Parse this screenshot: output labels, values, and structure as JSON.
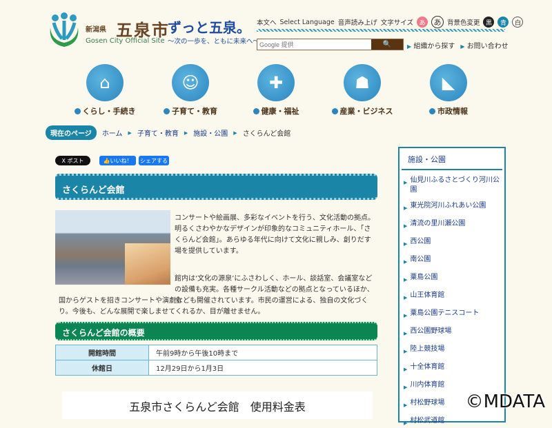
{
  "header": {
    "prefecture": "新潟県",
    "city": "五泉市",
    "english": "Gosen City Official Site",
    "slogan": "ずっと五泉。",
    "slogan_sub": "〜次の一歩を、ともに未来へ〜"
  },
  "utility": {
    "skip": "本文へ",
    "language": "Select Language",
    "read_aloud": "音声読み上げ",
    "font_size": "文字サイズ",
    "font_large": "あ",
    "font_normal": "あ",
    "bg_color": "背景色変更",
    "bg_black": "黒",
    "bg_blue": "青",
    "bg_white": "白"
  },
  "search": {
    "placeholder": "Google 提供",
    "button_icon": "search-icon"
  },
  "links": {
    "org": "組織から探す",
    "contact": "お問い合わせ"
  },
  "nav": [
    {
      "label": "くらし・手続き",
      "icon": "house-icon"
    },
    {
      "label": "子育て・教育",
      "icon": "baby-icon"
    },
    {
      "label": "健康・福祉",
      "icon": "health-icon"
    },
    {
      "label": "産業・ビジネス",
      "icon": "business-icon"
    },
    {
      "label": "市政情報",
      "icon": "city-icon"
    }
  ],
  "breadcrumb": {
    "current_label": "現在のページ",
    "items": [
      "ホーム",
      "子育て・教育",
      "施設・公園",
      "さくらんど会館"
    ]
  },
  "share": {
    "x": "X ポスト",
    "like": "いいね！",
    "share": "シェアする"
  },
  "page": {
    "title": "さくらんど会館",
    "para1": "コンサートや絵画展、多彩なイベントを行う、文化活動の拠点。明るくさわやかなデザインが印象的なコミュニティホール、「さくらんど会館」。あらゆる年代に向けて文化に親しみ、創りだす場を提供しています。",
    "para2a": "館内は‘文化の源泉’にふさわしく、ホール、談話室、会議室などの設備も充実。各種サークル活動などの拠点となっているほか、全",
    "para2b": "国からゲストを招きコンサートや演劇なども開催されています。市民の運営による、独自の文化づくり。今後も、どんな展開で楽しませてくれるか、目が離せません。",
    "overview_title": "さくらんど会館の概要",
    "overview": [
      {
        "label": "開館時間",
        "value": "午前9時から午後10時まで"
      },
      {
        "label": "休館日",
        "value": "12月29日から1月3日"
      }
    ],
    "fee_title": "五泉市さくらんど会館　使用料金表"
  },
  "sidebar": {
    "title": "施設・公園",
    "items": [
      "仙見川ふるさとづくり河川公園",
      "東光院河川ふれあい公園",
      "清流の里川瀬公園",
      "西公園",
      "南公園",
      "粟島公園",
      "山王体育館",
      "粟島公園テニスコート",
      "西公園野球場",
      "陸上競技場",
      "十全体育館",
      "川内体育館",
      "村松野球場",
      "村松武道館"
    ]
  },
  "watermark": "©MDATA",
  "colors": {
    "accent": "#1b85a8",
    "green": "#0b8552",
    "brown": "#5a3410",
    "bg": "#fbf8ee"
  }
}
